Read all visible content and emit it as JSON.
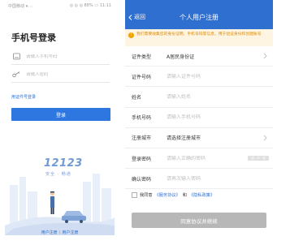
{
  "login": {
    "status_left": "中国移动 ▾ᵢ ᵢ ᵢ",
    "status_right": "◎ ◎ ◎ 88% ▭ 11:11",
    "title": "手机号登录",
    "phone_placeholder": "请输入手机号码",
    "password_placeholder": "请输入密码",
    "cert_link": "用证件号登录",
    "login_button": "登录",
    "brand_logo": "12123",
    "brand_slogan": "安全 · 畅通",
    "footer_register": "用户注册",
    "footer_sep": "|",
    "footer_other": "用户注册"
  },
  "register": {
    "back_label": "返回",
    "title": "个人用户注册",
    "notice": "我们需要收集您的身份证明、手机号码等信息，用于验证身份和创建账号",
    "rows": [
      {
        "label": "证件类型",
        "value": "A居民身份证",
        "placeholder": ""
      },
      {
        "label": "证件号码",
        "value": "",
        "placeholder": "请输入证件号码"
      },
      {
        "label": "姓名",
        "value": "",
        "placeholder": "请输入姓名"
      },
      {
        "label": "手机号码",
        "value": "",
        "placeholder": "请输入手机号码"
      },
      {
        "label": "注册城市",
        "value": "请选择注册城市",
        "placeholder": ""
      },
      {
        "label": "登录密码",
        "value": "",
        "placeholder": "请输入正确的密码"
      },
      {
        "label": "确认密码",
        "value": "",
        "placeholder": "请再次输入密码"
      }
    ],
    "password_strength": "弱 · 中 · 强",
    "agree_prefix": "我同意",
    "agree_link1": "《服务协议》",
    "agree_and": "和",
    "agree_link2": "《隐私政策》",
    "submit_button": "同意协议并继续"
  },
  "colors": {
    "primary": "#2e76e0",
    "nav": "#2f6fd0",
    "notice_bg": "#fdf4e1",
    "notice_text": "#e08a00",
    "disabled_button": "#b7b7b7"
  }
}
